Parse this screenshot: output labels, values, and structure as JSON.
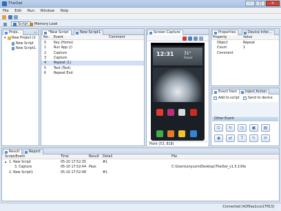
{
  "app": {
    "title": "TheOwl"
  },
  "menu": [
    "File",
    "Edit",
    "Run",
    "Window",
    "Help"
  ],
  "perspectives": [
    {
      "label": "Script",
      "active": true
    },
    {
      "label": "Memory Leak",
      "active": false
    }
  ],
  "project_panel": {
    "tab": "Proje...",
    "tree": [
      {
        "label": "New Project (2"
      },
      {
        "label": "New Script"
      },
      {
        "label": "New Script1"
      }
    ]
  },
  "script_panel": {
    "tabs": [
      {
        "label": "*New Script"
      },
      {
        "label": "New Script1"
      }
    ],
    "columns": {
      "no": "No.",
      "event": "Event",
      "comment": "Comment"
    },
    "rows": [
      {
        "no": "0",
        "event": "Key (Home)"
      },
      {
        "no": "1",
        "event": "Run App (/)"
      },
      {
        "no": "2",
        "event": "Capture"
      },
      {
        "no": "3",
        "event": "Capture"
      },
      {
        "no": "4",
        "event": "Repeat (1)"
      },
      {
        "no": "5",
        "event": "Text (Text)"
      },
      {
        "no": "6",
        "event": "Repeat End"
      }
    ]
  },
  "capture_panel": {
    "tab": "Screen Capture",
    "point": "Point (53, 818)",
    "phone": {
      "time": "12:31",
      "temp": "31°",
      "weather": "Seoul"
    }
  },
  "properties_panel": {
    "tabs": [
      {
        "label": "Properties"
      },
      {
        "label": "Device Infor..."
      }
    ],
    "columns": {
      "property": "Property",
      "value": "Value"
    },
    "rows": [
      {
        "property": "Object",
        "value": "Repeat"
      },
      {
        "property": "Count",
        "value": "1"
      },
      {
        "property": "Comment",
        "value": ""
      }
    ]
  },
  "event_panel": {
    "tabs": [
      {
        "label": "Event Item"
      },
      {
        "label": "Inject Action"
      }
    ],
    "add_to_script": "Add to script",
    "send_to_device": "Send to device",
    "other_event": "Other Event"
  },
  "result_panel": {
    "tabs": [
      {
        "label": "Result"
      },
      {
        "label": "Report"
      }
    ],
    "columns": {
      "script": "Script/Event",
      "time": "Time",
      "result": "Result",
      "detail": "Detail",
      "file": "File"
    },
    "rows": [
      {
        "script": "1. New Script",
        "time": "05-10 17:52:35",
        "result": "",
        "detail": "#1",
        "file": ""
      },
      {
        "script": "3. Capture",
        "time": "05-10 17:52:44",
        "result": "Pass",
        "detail": "",
        "file": "C:\\Users\\onycom\\Desktop\\TheOwl_v1.5.1\\file"
      },
      {
        "script": "2. New Script1",
        "time": "05-10 17:52:48",
        "result": "",
        "detail": "#1",
        "file": ""
      }
    ]
  },
  "statusbar": {
    "connection": "Connected [42f0ea1cce17ff13]"
  },
  "colors": {
    "accent": "#3a7bc8",
    "selection": "#cfe0f5",
    "frame": "#9fb3cc"
  }
}
